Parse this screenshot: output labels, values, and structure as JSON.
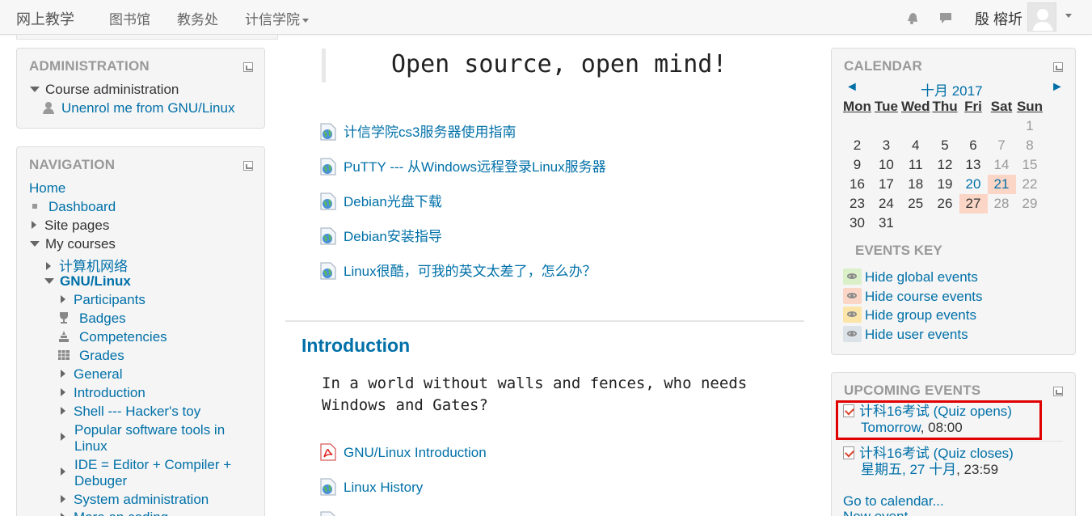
{
  "navbar": {
    "brand": "网上教学",
    "links": [
      "图书馆",
      "教务处",
      "计信学院"
    ],
    "user_name": "殷 榕圻",
    "icons": [
      "notification-icon",
      "message-icon",
      "avatar"
    ]
  },
  "admin_block": {
    "title": "ADMINISTRATION",
    "course_admin": "Course administration",
    "unenrol": "Unenrol me from GNU/Linux"
  },
  "nav_block": {
    "title": "NAVIGATION",
    "home": "Home",
    "dashboard": "Dashboard",
    "site_pages": "Site pages",
    "my_courses": "My courses",
    "course1": "计算机网络",
    "course2": "GNU/Linux",
    "participants": "Participants",
    "badges": "Badges",
    "competencies": "Competencies",
    "grades": "Grades",
    "general": "General",
    "introduction": "Introduction",
    "shell": "Shell --- Hacker's toy",
    "popular1": "Popular software tools in",
    "popular2": "Linux",
    "ide1": "IDE = Editor + Compiler +",
    "ide2": "Debuger",
    "sysadmin": "System administration",
    "more": "More on coding"
  },
  "main": {
    "quote": "Open source, open mind!",
    "links": [
      "计信学院cs3服务器使用指南",
      "PuTTY --- 从Windows远程登录Linux服务器",
      "Debian光盘下载",
      "Debian安装指导",
      "Linux很酷，可我的英文太差了，怎么办？"
    ],
    "section_title": "Introduction",
    "intro_line1": "In a world without walls and fences, who needs",
    "intro_line2": "Windows and Gates?",
    "intro_links": [
      "GNU/Linux Introduction",
      "Linux History"
    ]
  },
  "calendar": {
    "title": "CALENDAR",
    "prev": "◄",
    "next": "►",
    "month": "十月 2017",
    "weekdays": [
      "Mon",
      "Tue",
      "Wed",
      "Thu",
      "Fri",
      "Sat",
      "Sun"
    ],
    "days": [
      [
        "",
        "",
        "",
        "",
        "",
        "",
        "1"
      ],
      [
        "2",
        "3",
        "4",
        "5",
        "6",
        "7",
        "8"
      ],
      [
        "9",
        "10",
        "11",
        "12",
        "13",
        "14",
        "15"
      ],
      [
        "16",
        "17",
        "18",
        "19",
        "20",
        "21",
        "22"
      ],
      [
        "23",
        "24",
        "25",
        "26",
        "27",
        "28",
        "29"
      ],
      [
        "30",
        "31",
        "",
        "",
        "",
        "",
        ""
      ]
    ],
    "events_key_title": "EVENTS KEY",
    "events_key": [
      {
        "label": "Hide global events",
        "color": "#d9f0c9"
      },
      {
        "label": "Hide course events",
        "color": "#fbd6c6"
      },
      {
        "label": "Hide group events",
        "color": "#fce5a9"
      },
      {
        "label": "Hide user events",
        "color": "#dbe2e8"
      }
    ]
  },
  "upcoming": {
    "title": "UPCOMING EVENTS",
    "events": [
      {
        "name": "计科16考试 (Quiz opens)",
        "date_link": "Tomorrow",
        "time": ", 08:00"
      },
      {
        "name": "计科16考试 (Quiz closes)",
        "date_link": "星期五, 27 十月",
        "time": ", 23:59"
      }
    ],
    "goto_calendar": "Go to calendar...",
    "new_event": "New event..."
  }
}
